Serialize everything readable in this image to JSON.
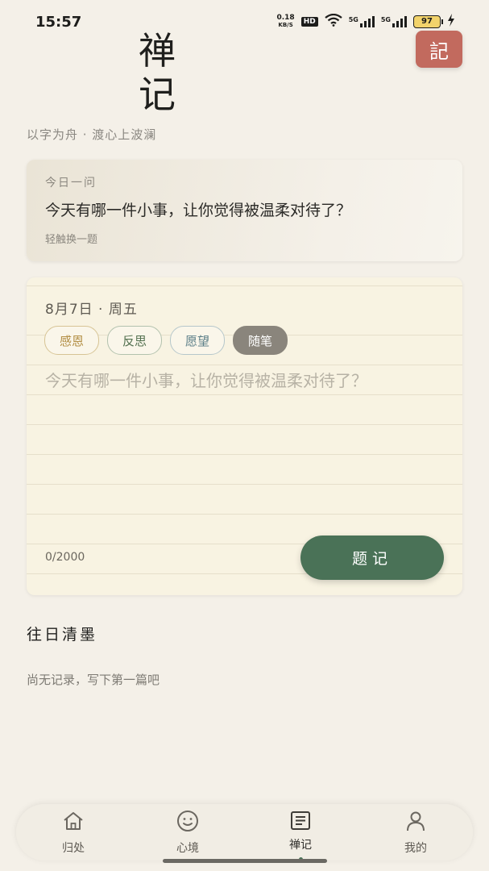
{
  "status_bar": {
    "time": "15:57",
    "net_speed_value": "0.18",
    "net_speed_unit": "KB/S",
    "hd_label": "HD",
    "sim1_label": "5G",
    "sim2_label": "5G",
    "battery": "97"
  },
  "header": {
    "title_line1": "禅",
    "title_line2": "记",
    "subtitle": "以字为舟 · 渡心上波澜",
    "badge": "記"
  },
  "daily_question": {
    "label": "今日一问",
    "question": "今天有哪一件小事，让你觉得被温柔对待了？",
    "switch_hint": "轻触换一题"
  },
  "editor": {
    "date": "8月7日 · 周五",
    "tags": [
      {
        "label": "感恩"
      },
      {
        "label": "反思"
      },
      {
        "label": "愿望"
      },
      {
        "label": "随笔",
        "selected": true
      }
    ],
    "placeholder": "今天有哪一件小事，让你觉得被温柔对待了？",
    "char_count": "0/2000",
    "submit_label": "题记"
  },
  "history": {
    "heading": "往日清墨",
    "empty_text": "尚无记录，写下第一篇吧"
  },
  "tab_bar": {
    "items": [
      {
        "label": "归处",
        "icon": "home-icon"
      },
      {
        "label": "心境",
        "icon": "smile-icon"
      },
      {
        "label": "禅记",
        "icon": "journal-icon",
        "active": true
      },
      {
        "label": "我的",
        "icon": "person-icon"
      }
    ]
  },
  "colors": {
    "background": "#f4f0e8",
    "accent_green": "#4a7257",
    "badge_red": "#c26a5e",
    "selected_tag": "#8a857c"
  }
}
